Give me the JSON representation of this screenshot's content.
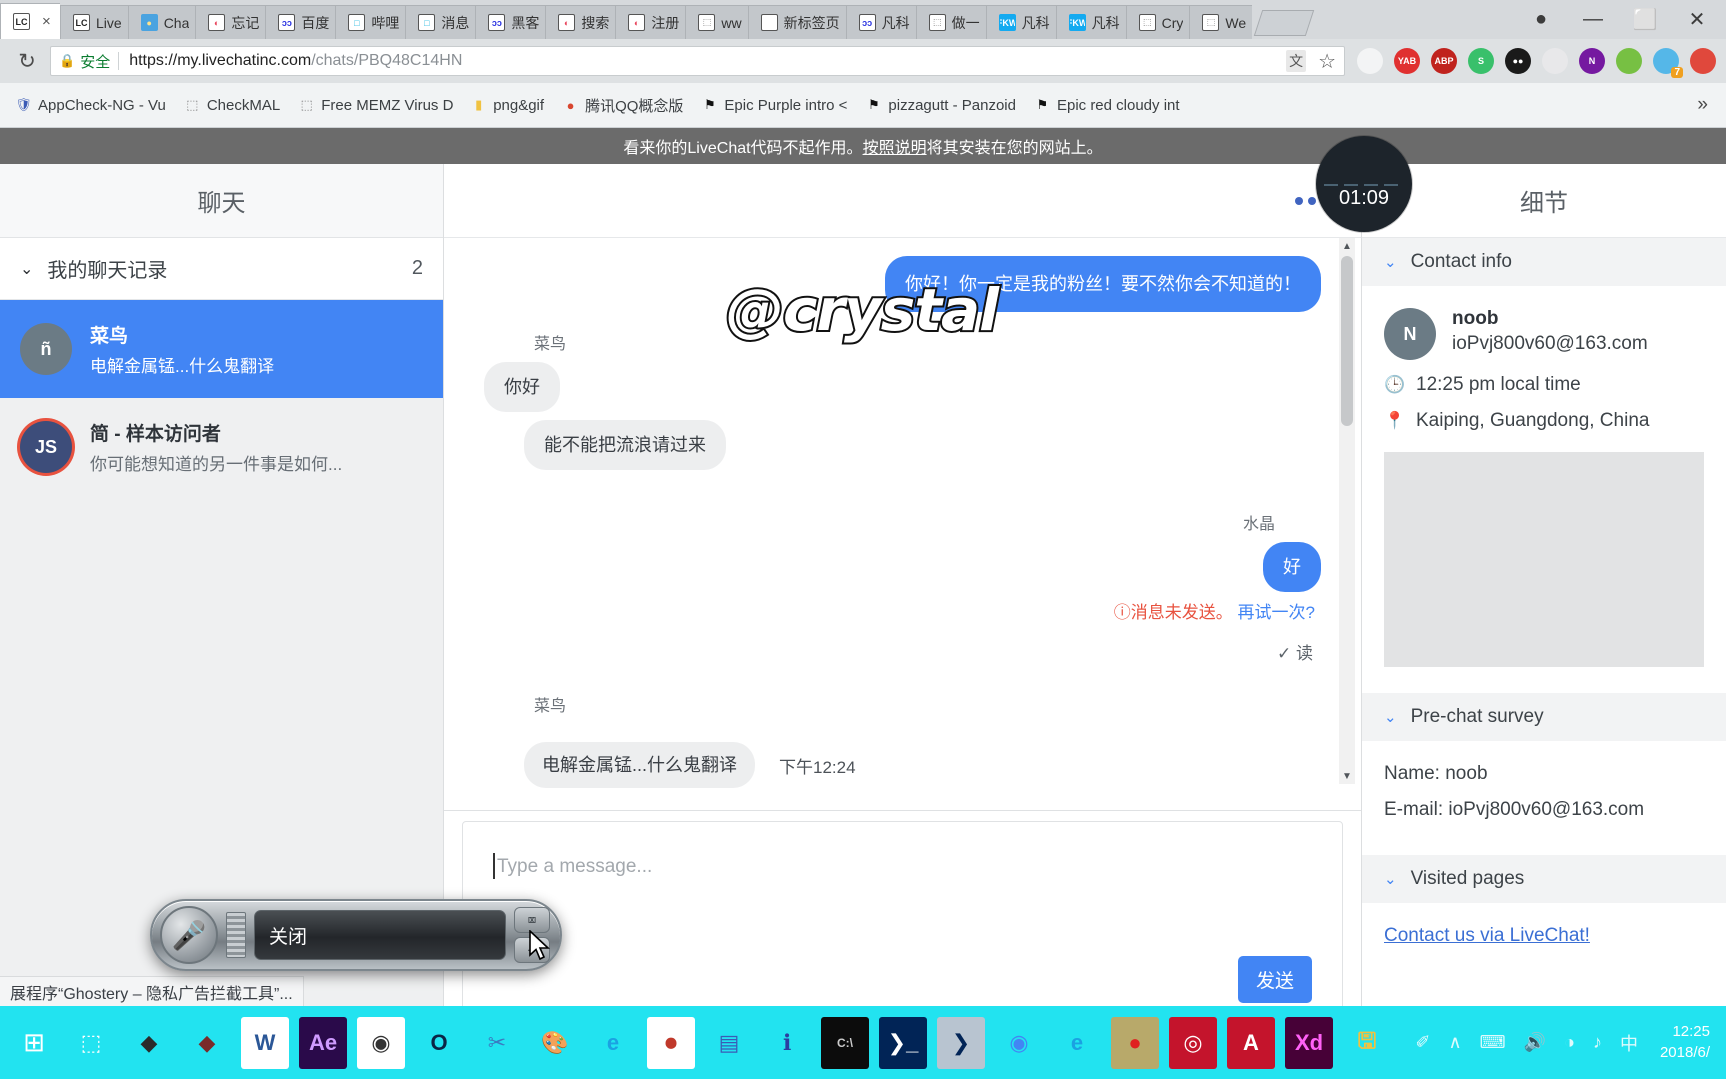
{
  "browser": {
    "tabs": [
      {
        "label": "",
        "icon": "livechat-icon",
        "icon_text": "LC",
        "icon_bg": "#ffffff",
        "icon_color": "#222222",
        "active": true,
        "close": "×"
      },
      {
        "label": "Live",
        "icon": "livechat-icon",
        "icon_text": "LC",
        "icon_bg": "#ffffff",
        "icon_color": "#222222",
        "active": false
      },
      {
        "label": "Cha",
        "icon": "chat-bubble-icon",
        "icon_text": "●",
        "icon_bg": "#4aa3e0",
        "icon_color": "#ffe28a",
        "active": false
      },
      {
        "label": "忘记",
        "icon": "sogou-icon",
        "icon_text": "◐",
        "icon_bg": "#ffffff",
        "icon_color": "#e8425a",
        "active": false
      },
      {
        "label": "百度",
        "icon": "baidu-icon",
        "icon_text": "ɔɔ",
        "icon_bg": "#ffffff",
        "icon_color": "#2932e1",
        "active": false
      },
      {
        "label": "哔哩",
        "icon": "bilibili-icon",
        "icon_text": "□",
        "icon_bg": "#ffffff",
        "icon_color": "#22b8e0",
        "active": false
      },
      {
        "label": "消息",
        "icon": "bilibili-icon",
        "icon_text": "□",
        "icon_bg": "#ffffff",
        "icon_color": "#22b8e0",
        "active": false
      },
      {
        "label": "黑客",
        "icon": "baidu-icon",
        "icon_text": "ɔɔ",
        "icon_bg": "#ffffff",
        "icon_color": "#2932e1",
        "active": false
      },
      {
        "label": "搜索",
        "icon": "sogou-icon",
        "icon_text": "◐",
        "icon_bg": "#ffffff",
        "icon_color": "#e8425a",
        "active": false
      },
      {
        "label": "注册",
        "icon": "sogou-icon",
        "icon_text": "◐",
        "icon_bg": "#ffffff",
        "icon_color": "#e8425a",
        "active": false
      },
      {
        "label": "ww",
        "icon": "page-icon",
        "icon_text": "⬚",
        "icon_bg": "#ffffff",
        "icon_color": "#777777",
        "active": false
      },
      {
        "label": "新标签页",
        "icon": "page-icon",
        "icon_text": "",
        "icon_bg": "#ffffff",
        "icon_color": "#777777",
        "active": false
      },
      {
        "label": "凡科",
        "icon": "baidu-icon",
        "icon_text": "ɔɔ",
        "icon_bg": "#ffffff",
        "icon_color": "#2932e1",
        "active": false
      },
      {
        "label": "做一",
        "icon": "page-icon",
        "icon_text": "⬚",
        "icon_bg": "#ffffff",
        "icon_color": "#777777",
        "active": false
      },
      {
        "label": "凡科",
        "icon": "fkw-icon",
        "icon_text": "FKW",
        "icon_bg": "#14aaf0",
        "icon_color": "#ffffff",
        "active": false
      },
      {
        "label": "凡科",
        "icon": "fkw-icon",
        "icon_text": "FKW",
        "icon_bg": "#14aaf0",
        "icon_color": "#ffffff",
        "active": false
      },
      {
        "label": "Cry",
        "icon": "page-icon",
        "icon_text": "⬚",
        "icon_bg": "#ffffff",
        "icon_color": "#777777",
        "active": false
      },
      {
        "label": "We",
        "icon": "page-icon",
        "icon_text": "⬚",
        "icon_bg": "#ffffff",
        "icon_color": "#777777",
        "active": false
      }
    ],
    "window_controls": {
      "profile": "●",
      "minimize": "—",
      "maximize": "⬜",
      "close": "✕"
    },
    "reload_icon": "↻",
    "security_lock": "🔒",
    "security_label": "安全",
    "url_base": "https://my.livechatinc.com",
    "url_path": "/chats/PBQ48C14HN",
    "translate_icon": "文",
    "star_icon": "☆",
    "extensions": [
      {
        "name": "ghostery-extension-icon",
        "text": "",
        "bg": "#f3f4f5",
        "color": "#4a8fc4"
      },
      {
        "name": "yandex-extension-icon",
        "text": "YAB",
        "bg": "#e03030",
        "color": "#ffffff"
      },
      {
        "name": "adblock-plus-extension-icon",
        "text": "ABP",
        "bg": "#c0231e",
        "color": "#ffffff"
      },
      {
        "name": "s-extension-icon",
        "text": "S",
        "bg": "#39c06b",
        "color": "#ffffff"
      },
      {
        "name": "momentum-extension-icon",
        "text": "●●",
        "bg": "#1a1a1a",
        "color": "#ffffff"
      },
      {
        "name": "office-extension-icon",
        "text": "",
        "bg": "#e8e8ea",
        "color": "#e8622c"
      },
      {
        "name": "onenote-extension-icon",
        "text": "N",
        "bg": "#7519a0",
        "color": "#ffffff"
      },
      {
        "name": "wechat-extension-icon",
        "text": "",
        "bg": "#77c043",
        "color": "#ffffff"
      },
      {
        "name": "ghostery-badge-extension-icon",
        "text": "",
        "bg": "#55b7e8",
        "color": "#ffffff",
        "badge": "7"
      },
      {
        "name": "colorpick-extension-icon",
        "text": "",
        "bg": "#e0483c",
        "color": "#ffffff"
      }
    ],
    "bookmarks": [
      {
        "label": "AppCheck-NG - Vu",
        "icon": "shield-icon",
        "icon_char": "🛡",
        "color": "#3b5bb5"
      },
      {
        "label": "CheckMAL",
        "icon": "page-icon",
        "icon_char": "⬚",
        "color": "#888888"
      },
      {
        "label": "Free MEMZ Virus D",
        "icon": "page-icon",
        "icon_char": "⬚",
        "color": "#888888"
      },
      {
        "label": "png&gif",
        "icon": "folder-icon",
        "icon_char": "▮",
        "color": "#f0c241"
      },
      {
        "label": "腾讯QQ概念版",
        "icon": "qq-penguin-icon",
        "icon_char": "●",
        "color": "#d8462f"
      },
      {
        "label": "Epic Purple intro <",
        "icon": "flag-icon",
        "icon_char": "⚑",
        "color": "#111111"
      },
      {
        "label": "pizzagutt - Panzoid",
        "icon": "flag-icon",
        "icon_char": "⚑",
        "color": "#111111"
      },
      {
        "label": "Epic red cloudy int",
        "icon": "flag-icon",
        "icon_char": "⚑",
        "color": "#111111"
      }
    ],
    "bookmarks_overflow": "»",
    "status_bar_text": "展程序“Ghostery – 隐私广告拦截工具”..."
  },
  "watermark": "@crystal",
  "banner": {
    "text_before": "看来你的LiveChat代码不起作用。",
    "link_text": "按照说明",
    "text_after": "将其安装在您的网站上。"
  },
  "chat_list": {
    "title": "聊天",
    "section_label": "我的聊天记录",
    "section_count": "2",
    "chevron": "⌄",
    "items": [
      {
        "name": "菜鸟",
        "preview": "电解金属锰...什么鬼翻译",
        "avatar_text": "ñ",
        "avatar_bg": "#6b7b85",
        "selected": true,
        "ring": false
      },
      {
        "name": "简 - 样本访问者",
        "preview": "你可能想知道的另一件事是如何...",
        "avatar_text": "JS",
        "avatar_bg": "#3d4d7a",
        "selected": false,
        "ring": true
      }
    ]
  },
  "conversation": {
    "menu_icon": "more-horizontal-icon",
    "messages": [
      {
        "dir": "out",
        "sender": "",
        "text": "你好！你一定是我的粉丝！要不然你会不知道的！"
      },
      {
        "dir": "in",
        "sender": "菜鸟",
        "text": "你好"
      },
      {
        "dir": "in",
        "sender": "",
        "text": "能不能把流浪请过来",
        "indent": true
      },
      {
        "dir": "out",
        "sender": "水晶",
        "text": "好"
      }
    ],
    "error_prefix": "ⓘ消息未发送。",
    "error_link": "再试一次?",
    "read_check": "✓",
    "read_label": "读",
    "last_message": {
      "sender": "菜鸟",
      "text": "电解金属锰...什么鬼翻译",
      "time": "下午12:24"
    },
    "scroll_up": "▲",
    "scroll_down": "▼"
  },
  "composer": {
    "placeholder": "Type a message...",
    "send_label": "发送"
  },
  "details": {
    "title": "细节",
    "close_icon": "✕",
    "timer_overlay": "01:09",
    "sections": {
      "contact_info": "Contact info",
      "pre_chat_survey": "Pre-chat survey",
      "visited_pages": "Visited pages"
    },
    "contact": {
      "avatar_text": "N",
      "avatar_bg": "#6b7b85",
      "name": "noob",
      "email": "ioPvj800v60@163.com",
      "clock_icon": "🕒",
      "local_time": "12:25 pm local time",
      "pin_icon": "📍",
      "location": "Kaiping, Guangdong, China"
    },
    "survey": {
      "name_line": "Name: noob",
      "email_line": "E-mail: ioPvj800v60@163.com"
    },
    "visited": {
      "first_page": "Contact us via LiveChat!"
    },
    "chevron": "⌄"
  },
  "speech_bar": {
    "mic_icon": "🎙",
    "status_text": "关闭",
    "close_btn": "⌧",
    "minimize_btn": "−"
  },
  "taskbar": {
    "start_icon": "⊞",
    "items": [
      {
        "name": "taskview-icon",
        "text": "⬚",
        "bg": "transparent",
        "color": "#ffffff"
      },
      {
        "name": "dark-diamond-icon",
        "text": "◆",
        "bg": "transparent",
        "color": "#2b2b2b"
      },
      {
        "name": "red-folder-icon",
        "text": "◆",
        "bg": "transparent",
        "color": "#7a2a2a"
      },
      {
        "name": "word-icon",
        "text": "W",
        "bg": "#ffffff",
        "color": "#2b5797"
      },
      {
        "name": "after-effects-icon",
        "text": "Ae",
        "bg": "#2a0a4a",
        "color": "#cf9bff"
      },
      {
        "name": "camera-icon",
        "text": "◉",
        "bg": "#ffffff",
        "color": "#333333"
      },
      {
        "name": "opera-icon",
        "text": "O",
        "bg": "transparent",
        "color": "#0b2545"
      },
      {
        "name": "snip-tool-icon",
        "text": "✂",
        "bg": "transparent",
        "color": "#3a7ac0"
      },
      {
        "name": "paint-icon",
        "text": "🎨",
        "bg": "transparent",
        "color": "#e06c2c"
      },
      {
        "name": "internet-explorer-icon",
        "text": "e",
        "bg": "transparent",
        "color": "#1ba1e2"
      },
      {
        "name": "recorder-icon",
        "text": "⏺",
        "bg": "#ffffff",
        "color": "#c0392b"
      },
      {
        "name": "scanner-icon",
        "text": "▤",
        "bg": "transparent",
        "color": "#3b5bb5"
      },
      {
        "name": "info-icon",
        "text": "ℹ",
        "bg": "transparent",
        "color": "#2b3ea0"
      },
      {
        "name": "cmd-icon",
        "text": "C:\\",
        "bg": "#0c0c0c",
        "color": "#cccccc"
      },
      {
        "name": "powershell-icon",
        "text": "❯_",
        "bg": "#012456",
        "color": "#ffffff"
      },
      {
        "name": "powershell-ise-icon",
        "text": "❯",
        "bg": "#b8c4d0",
        "color": "#012456"
      },
      {
        "name": "chrome-icon",
        "text": "◉",
        "bg": "transparent",
        "color": "#4285f4"
      },
      {
        "name": "edge-icon",
        "text": "e",
        "bg": "transparent",
        "color": "#1ba1e2"
      },
      {
        "name": "media-player-icon",
        "text": "●",
        "bg": "#b8a96a",
        "color": "#e02020",
        "active": true
      },
      {
        "name": "creative-cloud-icon",
        "text": "◎",
        "bg": "#c4142c",
        "color": "#ffffff"
      },
      {
        "name": "adobe-icon",
        "text": "A",
        "bg": "#c4142c",
        "color": "#ffffff"
      },
      {
        "name": "xd-icon",
        "text": "Xd",
        "bg": "#470137",
        "color": "#ff61f6"
      },
      {
        "name": "save-folder-icon",
        "text": "🖫",
        "bg": "transparent",
        "color": "#f0c241"
      }
    ],
    "tray": [
      "✐",
      "∧",
      "⌨",
      "🔊",
      "◑",
      "♪",
      "中"
    ],
    "clock_time": "12:25",
    "clock_date": "2018/6/"
  }
}
